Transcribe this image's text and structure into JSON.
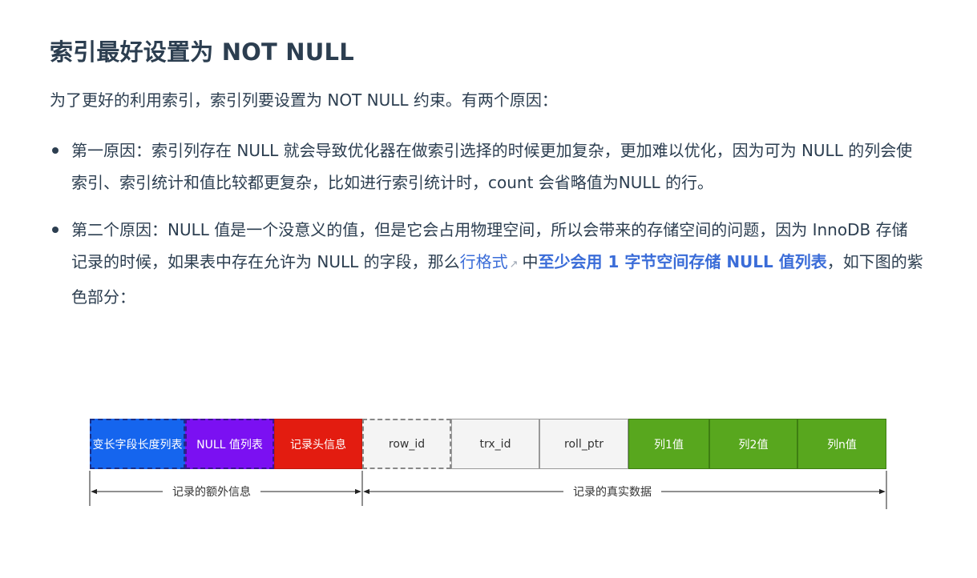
{
  "heading": "索引最好设置为 NOT NULL",
  "intro": "为了更好的利用索引，索引列要设置为 NOT NULL 约束。有两个原因：",
  "bullet1": {
    "text": "第一原因：索引列存在 NULL 就会导致优化器在做索引选择的时候更加复杂，更加难以优化，因为可为 NULL 的列会使索引、索引统计和值比较都更复杂，比如进行索引统计时，count 会省略值为NULL 的行。"
  },
  "bullet2": {
    "text_before": "第二个原因：NULL 值是一个没意义的值，但是它会占用物理空间，所以会带来的存储空间的问题，因为 InnoDB 存储记录的时候，如果表中存在允许为 NULL 的字段，那么",
    "link": "行格式",
    "ext_icon": "↗",
    "text_mid": "中",
    "strong": "至少会用 1 字节空间存储 NULL 值列表",
    "text_after": "，如下图的紫色部分："
  },
  "diagram": {
    "cells": [
      "变长字段长度列表",
      "NULL 值列表",
      "记录头信息",
      "row_id",
      "trx_id",
      "roll_ptr",
      "列1值",
      "列2值",
      "列n值"
    ],
    "extra_label": "记录的额外信息",
    "real_label": "记录的真实数据",
    "colors": {
      "blue": "#1565ee",
      "purple": "#7b10f2",
      "red": "#e31c10",
      "gray": "#f4f4f4",
      "green": "#58a71e"
    }
  }
}
